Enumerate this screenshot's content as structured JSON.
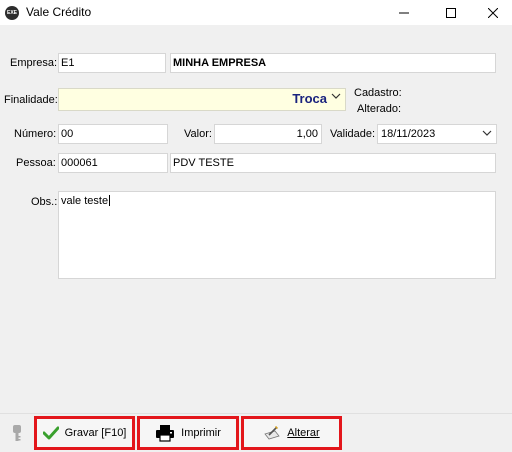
{
  "window": {
    "title": "Vale Crédito"
  },
  "form": {
    "empresa": {
      "label": "Empresa:",
      "code": "E1",
      "name": "MINHA EMPRESA"
    },
    "finalidade": {
      "label": "Finalidade:",
      "value": "Troca"
    },
    "cadastro_label": "Cadastro:",
    "alterado_label": "Alterado:",
    "numero": {
      "label": "Número:",
      "value": "00"
    },
    "valor": {
      "label": "Valor:",
      "value": "1,00"
    },
    "validade": {
      "label": "Validade:",
      "value": "18/11/2023"
    },
    "pessoa": {
      "label": "Pessoa:",
      "code": "000061",
      "name": "PDV TESTE"
    },
    "obs": {
      "label": "Obs.:",
      "value": "vale teste"
    }
  },
  "buttons": {
    "gravar": "Gravar [F10]",
    "imprimir": "Imprimir",
    "alterar": "Alterar"
  },
  "colors": {
    "highlight_border": "#e3161b",
    "combo_text": "#1a237e",
    "finalidade_bg": "#ffffe1"
  }
}
